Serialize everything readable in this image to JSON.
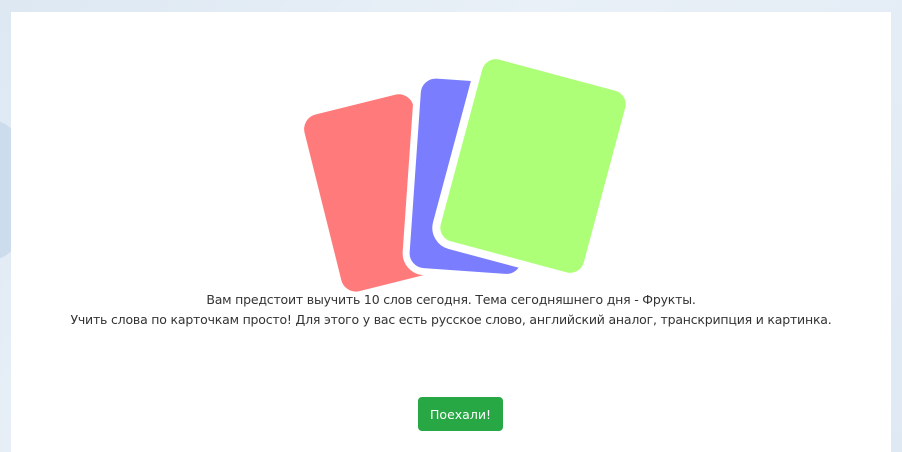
{
  "intro": {
    "line1": "Вам предстоит выучить 10 слов сегодня. Тема сегодняшнего дня - Фрукты.",
    "line2": "Учить слова по карточкам просто! Для этого у вас есть русское слово, английский аналог, транскрипция и картинка."
  },
  "actions": {
    "start_label": "Поехали!"
  },
  "illustration": {
    "icon": "flashcards-icon",
    "colors": {
      "red_card": "#ff7b7b",
      "blue_card": "#7b7dff",
      "green_card": "#adff78"
    }
  },
  "theme": {
    "button_color": "#28a745"
  }
}
